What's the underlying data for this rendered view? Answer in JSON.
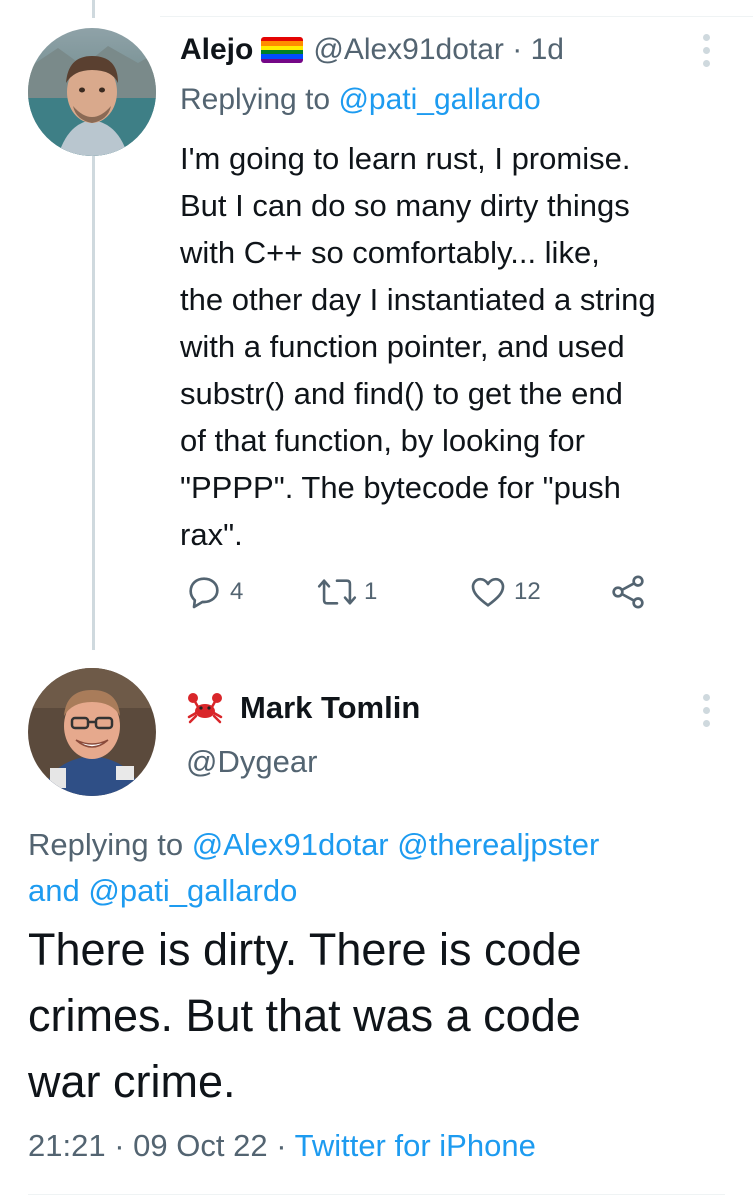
{
  "tweet1": {
    "display_name": "Alejo",
    "flag_icon": "rainbow-flag-icon",
    "handle": "@Alex91dotar",
    "separator": "·",
    "time": "1d",
    "replying_prefix": "Replying to",
    "replying_to": "@pati_gallardo",
    "body_lines": [
      "I'm going to learn rust, I promise.",
      "But I can do so many dirty things",
      "with C++ so comfortably... like,",
      "the other day I instantiated a string",
      "with a function pointer, and used",
      "substr() and find() to get the end",
      "of that function, by looking for",
      "\"PPPP\". The bytecode for \"push",
      "rax\"."
    ],
    "reply_count": "4",
    "retweet_count": "1",
    "like_count": "12"
  },
  "tweet2": {
    "name_emoji_icon": "crab-icon",
    "display_name": "Mark Tomlin",
    "handle": "@Dygear",
    "replying_prefix": "Replying to",
    "replying_to_1": "@Alex91dotar",
    "replying_to_2": "@therealjpster",
    "replying_and": "and",
    "replying_to_3": "@pati_gallardo",
    "body_lines": [
      "There is dirty. There is code",
      "crimes. But that was a code",
      "war crime."
    ],
    "time": "21:21",
    "separator": "·",
    "date": "09 Oct 22",
    "separator2": "·",
    "source": "Twitter for iPhone"
  },
  "colors": {
    "text": "#0f1419",
    "muted": "#536471",
    "link": "#1d9bf0",
    "thread_line": "#cfd9de"
  }
}
